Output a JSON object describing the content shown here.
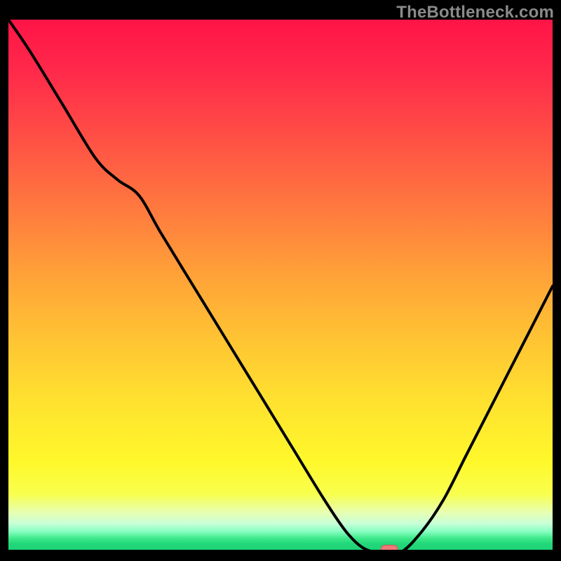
{
  "watermark": "TheBottleneck.com",
  "colors": {
    "background": "#000000",
    "watermark": "#8a8a8a",
    "curve": "#000000",
    "marker_fill": "#f07878",
    "marker_stroke": "#c85858"
  },
  "chart_data": {
    "type": "line",
    "title": "",
    "xlabel": "",
    "ylabel": "",
    "xlim": [
      0,
      100
    ],
    "ylim": [
      0,
      100
    ],
    "grid": false,
    "legend": false,
    "note": "No axes or tick labels are shown. Values are estimated to the nearest integer from pixel positions; x is left→right (0–100) and y is bottleneck percent (0 at bottom, 100 at top). Background gradient encodes quality: red=bad, green=good.",
    "series": [
      {
        "name": "bottleneck-curve",
        "x": [
          0,
          4,
          10,
          16,
          20,
          24,
          28,
          34,
          40,
          46,
          52,
          58,
          62,
          65,
          68,
          72,
          76,
          80,
          84,
          88,
          92,
          96,
          100
        ],
        "y": [
          100,
          94,
          84,
          74,
          70,
          67,
          60,
          50,
          40,
          30,
          20,
          10,
          4,
          1,
          0,
          0,
          4,
          10,
          18,
          26,
          34,
          42,
          50
        ]
      }
    ],
    "annotations": [
      {
        "name": "optimal-marker",
        "x": 70,
        "y": 0.6,
        "shape": "capsule",
        "color": "#f07878"
      }
    ],
    "gradient_stops": [
      {
        "pos": 0.0,
        "color": "#ff1447"
      },
      {
        "pos": 0.24,
        "color": "#ff5544"
      },
      {
        "pos": 0.48,
        "color": "#ffa238"
      },
      {
        "pos": 0.72,
        "color": "#ffe22f"
      },
      {
        "pos": 0.89,
        "color": "#f8ff4d"
      },
      {
        "pos": 0.96,
        "color": "#8affc3"
      },
      {
        "pos": 1.0,
        "color": "#1bcf74"
      }
    ]
  }
}
